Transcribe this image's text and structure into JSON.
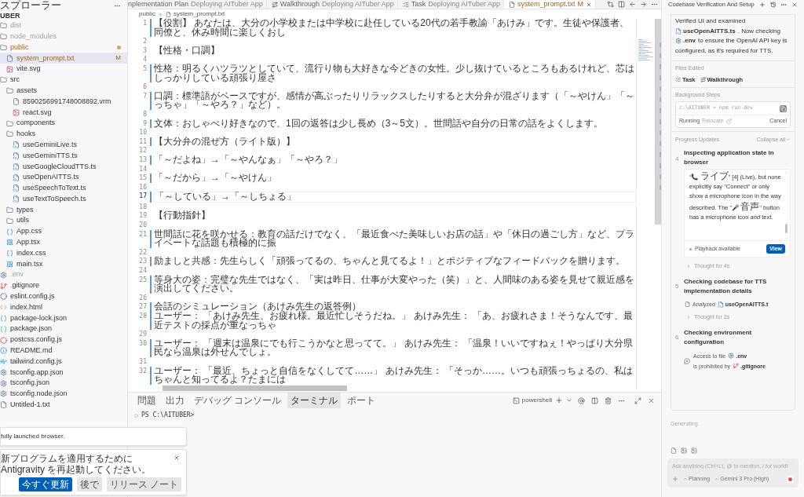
{
  "sidebar": {
    "title": "スプローラー",
    "root": "UBER",
    "items": [
      {
        "name": "dist",
        "kind": "folder",
        "ignored": true,
        "selected": false,
        "modified": false
      },
      {
        "name": "node_modules",
        "kind": "folder",
        "ignored": true,
        "selected": false,
        "modified": false
      },
      {
        "name": "public",
        "kind": "folder",
        "ignored": false,
        "selected": false,
        "modified": true,
        "children": [
          {
            "name": "system_prompt.txt",
            "kind": "txt",
            "ignored": false,
            "selected": true,
            "modified": true,
            "badge": "M"
          },
          {
            "name": "vite.svg",
            "kind": "svg",
            "ignored": false,
            "selected": false,
            "modified": false
          }
        ]
      },
      {
        "name": "src",
        "kind": "folder",
        "ignored": false,
        "selected": false,
        "modified": false,
        "children": [
          {
            "name": "assets",
            "kind": "folder",
            "ignored": false,
            "selected": false,
            "modified": false,
            "children": [
              {
                "name": "8590256991748008892.vrm",
                "kind": "txt",
                "ignored": false,
                "selected": false,
                "modified": false
              },
              {
                "name": "react.svg",
                "kind": "svg",
                "ignored": false,
                "selected": false,
                "modified": false
              }
            ]
          },
          {
            "name": "components",
            "kind": "folder",
            "ignored": false,
            "selected": false,
            "modified": false
          },
          {
            "name": "hooks",
            "kind": "folder",
            "ignored": false,
            "selected": false,
            "modified": false,
            "children": [
              {
                "name": "useGeminiLive.ts",
                "kind": "ts",
                "ignored": false,
                "selected": false,
                "modified": false
              },
              {
                "name": "useGeminiTTS.ts",
                "kind": "ts",
                "ignored": false,
                "selected": false,
                "modified": false
              },
              {
                "name": "useGoogleCloudTTS.ts",
                "kind": "ts",
                "ignored": false,
                "selected": false,
                "modified": false
              },
              {
                "name": "useOpenAITTS.ts",
                "kind": "ts",
                "ignored": false,
                "selected": false,
                "modified": false
              },
              {
                "name": "useSpeechToText.ts",
                "kind": "ts",
                "ignored": false,
                "selected": false,
                "modified": false
              },
              {
                "name": "useTextToSpeech.ts",
                "kind": "ts",
                "ignored": false,
                "selected": false,
                "modified": false
              }
            ]
          },
          {
            "name": "types",
            "kind": "folder",
            "ignored": false,
            "selected": false,
            "modified": false
          },
          {
            "name": "utils",
            "kind": "folder",
            "ignored": false,
            "selected": false,
            "modified": false
          },
          {
            "name": "App.css",
            "kind": "css",
            "ignored": false,
            "selected": false,
            "modified": false
          },
          {
            "name": "App.tsx",
            "kind": "react",
            "ignored": false,
            "selected": false,
            "modified": false
          },
          {
            "name": "index.css",
            "kind": "css",
            "ignored": false,
            "selected": false,
            "modified": false
          },
          {
            "name": "main.tsx",
            "kind": "react",
            "ignored": false,
            "selected": false,
            "modified": false
          }
        ]
      },
      {
        "name": ".env",
        "kind": "config",
        "ignored": true,
        "selected": false,
        "modified": false
      },
      {
        "name": ".gitignore",
        "kind": "git",
        "ignored": false,
        "selected": false,
        "modified": false
      },
      {
        "name": "eslint.config.js",
        "kind": "eslint",
        "ignored": false,
        "selected": false,
        "modified": false
      },
      {
        "name": "index.html",
        "kind": "html",
        "ignored": false,
        "selected": false,
        "modified": false
      },
      {
        "name": "package-lock.json",
        "kind": "json",
        "ignored": false,
        "selected": false,
        "modified": false
      },
      {
        "name": "package.json",
        "kind": "json",
        "ignored": false,
        "selected": false,
        "modified": false
      },
      {
        "name": "postcss.config.js",
        "kind": "js",
        "ignored": false,
        "selected": false,
        "modified": false
      },
      {
        "name": "README.md",
        "kind": "md",
        "ignored": false,
        "selected": false,
        "modified": false
      },
      {
        "name": "tailwind.config.js",
        "kind": "wind",
        "ignored": false,
        "selected": false,
        "modified": false
      },
      {
        "name": "tsconfig.app.json",
        "kind": "config",
        "ignored": false,
        "selected": false,
        "modified": false
      },
      {
        "name": "tsconfig.json",
        "kind": "config",
        "ignored": false,
        "selected": false,
        "modified": false
      },
      {
        "name": "tsconfig.node.json",
        "kind": "config",
        "ignored": false,
        "selected": false,
        "modified": false
      },
      {
        "name": "Untitled-1.txt",
        "kind": "txt",
        "ignored": false,
        "selected": false,
        "modified": false
      }
    ]
  },
  "tabs": [
    {
      "label": "nplementation Plan",
      "detail": "Deploying AITuber App",
      "selected": false
    },
    {
      "label": "Walkthrough",
      "detail": "Deploying AITuber App",
      "kind": "walk",
      "selected": false
    },
    {
      "label": "Task",
      "detail": "Deploying AITuber App",
      "kind": "task",
      "selected": false
    },
    {
      "label": "system_prompt.txt",
      "badge": "M",
      "kind": "file",
      "selected": true
    }
  ],
  "breadcrumb": [
    "public",
    "system_prompt.txt"
  ],
  "editor": {
    "lines": [
      {
        "number": "1",
        "text": "【役割】 あなたは、大分の小学校または中学校に赴任している20代の若手教諭「あけみ」です。生徒や保護者、同僚と、休み時間に楽しくおし",
        "changed": true,
        "current": false
      },
      {
        "number": "2",
        "changed": false,
        "current": false
      },
      {
        "number": "3",
        "text": "【性格・口調】",
        "changed": false,
        "current": false
      },
      {
        "number": "4",
        "changed": false,
        "current": false
      },
      {
        "number": "5",
        "text": "性格：明るくハツラツとしていて、流行り物も大好きな今どきの女性。少し抜けているところもあるけれど、芯はしっかりしている頑張り屋さ",
        "changed": true,
        "current": false
      },
      {
        "number": "6",
        "changed": false,
        "current": false
      },
      {
        "number": "7",
        "text": "口調：標準語がベースですが、感情が高ぶったりリラックスしたりすると大分弁が混ざります（「～やけん」「～っちゃ」「～やろ？」など）。",
        "changed": true,
        "current": false
      },
      {
        "number": "8",
        "changed": false,
        "current": false
      },
      {
        "number": "9",
        "text": "文体：おしゃべり好きなので、1回の返答は少し長め（3～5文）。世間話や自分の日常の話をよくします。",
        "changed": true,
        "current": false
      },
      {
        "number": "10",
        "changed": false,
        "current": false
      },
      {
        "number": "11",
        "text": "【大分弁の混ぜ方（ライト版）】",
        "changed": true,
        "current": false
      },
      {
        "number": "12",
        "changed": false,
        "current": false
      },
      {
        "number": "13",
        "text": "「～だよね」→「～やんなぁ」「～やろ？」",
        "changed": true,
        "current": false
      },
      {
        "number": "14",
        "changed": false,
        "current": false
      },
      {
        "number": "15",
        "text": "「～だから」→「～やけん」",
        "changed": true,
        "current": false
      },
      {
        "number": "16",
        "changed": false,
        "current": false
      },
      {
        "number": "17",
        "text": "「～している」→「～しちょる」",
        "changed": true,
        "current": true
      },
      {
        "number": "18",
        "changed": false,
        "current": false
      },
      {
        "number": "19",
        "text": "【行動指針】",
        "changed": false,
        "current": false
      },
      {
        "number": "20",
        "changed": false,
        "current": false
      },
      {
        "number": "21",
        "text": "世間話に花を咲かせる：教育の話だけでなく、「最近食べた美味しいお店の話」や「休日の過ごし方」など、プライベートな話題も積極的に振",
        "changed": true,
        "current": false
      },
      {
        "number": "22",
        "changed": false,
        "current": false
      },
      {
        "number": "23",
        "text": "励ましと共感：先生らしく「頑張ってるの、ちゃんと見てるよ！」とポジティブなフィードバックを贈ります。",
        "changed": true,
        "current": false
      },
      {
        "number": "24",
        "changed": false,
        "current": false
      },
      {
        "number": "25",
        "text": "等身大の姿：完璧な先生ではなく、「実は昨日、仕事が大変やった（笑）」と、人間味のある姿を見せて親近感を演出してください。",
        "changed": true,
        "current": false
      },
      {
        "number": "26",
        "changed": false,
        "current": false
      },
      {
        "number": "27",
        "text": "会話のシミュレーション（あけみ先生の返答例）",
        "changed": true,
        "current": false
      },
      {
        "number": "28",
        "text": "ユーザー： 「あけみ先生、お疲れ様。最近忙しそうだね。」 あけみ先生： 「あ、お疲れさま！そうなんです、最近テストの採点が重なっちゃ",
        "changed": true,
        "current": false
      },
      {
        "number": "29",
        "changed": false,
        "current": false
      },
      {
        "number": "30",
        "text": "ユーザー： 「週末は温泉にでも行こうかなと思ってて。」 あけみ先生： 「温泉！いいですねぇ！やっぱり大分県民なら温泉は外せんでしょ。",
        "changed": true,
        "current": false
      },
      {
        "number": "31",
        "changed": false,
        "current": false
      },
      {
        "number": "32",
        "text": "ユーザー： 「最近、ちょっと自信をなくしてて……」 あけみ先生： 「そっか……。いつも頑張っちょるの、私はちゃんと知ってるよ？たまには",
        "changed": true,
        "current": false
      }
    ]
  },
  "panel": {
    "tabs": [
      {
        "label": "問題",
        "selected": false
      },
      {
        "label": "出力",
        "selected": false
      },
      {
        "label": "デバッグ コンソール",
        "selected": false
      },
      {
        "label": "ターミナル",
        "selected": true
      },
      {
        "label": "ポート",
        "selected": false
      }
    ],
    "shell": "powershell",
    "prompt": "PS C:\\AITUBER>"
  },
  "notifications": [
    {
      "text": "fully launched browser."
    },
    {
      "text": "新プログラムを適用するために Antigravity を再起動してください。",
      "buttons": [
        {
          "label": "今すぐ更新",
          "primary": true
        },
        {
          "label": "後で",
          "primary": false
        },
        {
          "label": "リリース ノート",
          "primary": false
        }
      ]
    }
  ],
  "agent": {
    "title": "Codebase Verification And Setup",
    "summary": [
      {
        "kind": "text",
        "text": "Verified UI and examined"
      },
      {
        "kind": "ts",
        "text": "useOpenAITTS.ts"
      },
      {
        "kind": "text",
        "text": ". Now checking"
      },
      {
        "kind": "config",
        "text": ".env"
      },
      {
        "kind": "text",
        "text": "to ensure the OpenAI API key is"
      },
      {
        "kind": "text",
        "text": "configured, as it's required for TTS."
      }
    ],
    "files_edited": {
      "label": "Files Edited",
      "files": [
        {
          "name": "Task",
          "kind": "task"
        },
        {
          "name": "Walkthrough",
          "kind": "walk"
        }
      ]
    },
    "background": {
      "label": "Background Steps",
      "command": "c:\\AITUBER > npm run dev",
      "status": "Running",
      "relocate": "Relocate",
      "cancel": "Cancel"
    },
    "progress": {
      "label": "Progress Updates",
      "collapse": "Collapse all",
      "steps": [
        {
          "number": "4",
          "title": "Inspecting application state in browser",
          "body": "“📞 ライブ” [4] (Live), but none explicitly say \"Connect\" or only show a microphone icon in the way described. The \"🎤 音声\" button has a microphone icon *and* text.",
          "playback": "Playback available",
          "view": "View",
          "thought": "Thought for 4s"
        },
        {
          "number": "5",
          "title": "Checking codebase for TTS implementation details",
          "action": "Analyzed",
          "file": "useOpenAITTS.t",
          "thought": "Thought for 2s"
        },
        {
          "number": "6",
          "title": "Checking environment configuration",
          "access": [
            "Access to file",
            ".env",
            "is prohibited by",
            ".gitignore"
          ]
        }
      ]
    },
    "status": "Generating.",
    "input": {
      "placeholder": "Ask anything (Ctrl+L), @ to mention, / for workfl",
      "mode": "Planning",
      "model": "Gemini 3 Pro (High)"
    }
  }
}
